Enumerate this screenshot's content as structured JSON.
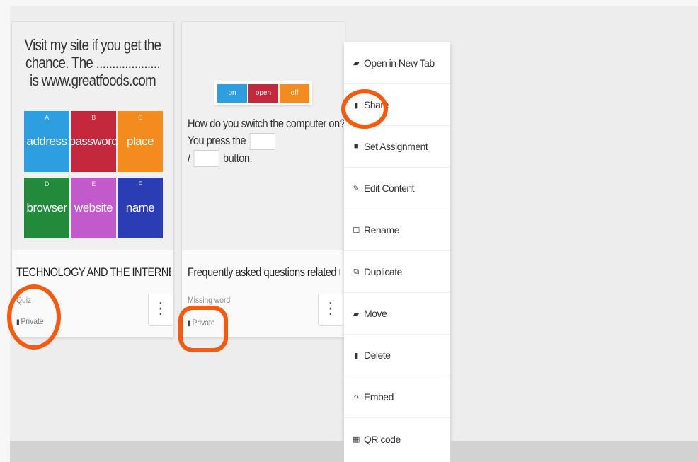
{
  "cards": [
    {
      "preview_text": "Visit my site if you get the chance. The .................... is www.greatfoods.com",
      "tiles": [
        {
          "num": "A",
          "label": "address",
          "color": "#2d9fe0"
        },
        {
          "num": "B",
          "label": "password",
          "color": "#c3283c"
        },
        {
          "num": "C",
          "label": "place",
          "color": "#f38b1e"
        },
        {
          "num": "D",
          "label": "browser",
          "color": "#238a3c"
        },
        {
          "num": "E",
          "label": "website",
          "color": "#c25acb"
        },
        {
          "num": "F",
          "label": "name",
          "color": "#2a3db4"
        }
      ],
      "title": "TECHNOLOGY AND THE INTERNET",
      "type": "Quiz",
      "privacy": "Private",
      "menu_icon": "⋮"
    },
    {
      "preview_buttons": [
        {
          "label": "on",
          "color": "#2d9fe0"
        },
        {
          "label": "open",
          "color": "#c3283c"
        },
        {
          "label": "off",
          "color": "#f38b1e"
        }
      ],
      "question": "How do you switch the computer on?",
      "line2_prefix": "You press the",
      "line3_prefix": "/",
      "line3_suffix": "button.",
      "title": "Frequently asked questions related t",
      "type": "Missing word",
      "privacy": "Private",
      "menu_icon": "⋮"
    }
  ],
  "context_menu": [
    {
      "label": "Open in New Tab",
      "icon": "folder-open-icon",
      "glyph": "▰"
    },
    {
      "label": "Share",
      "icon": "lock-icon",
      "glyph": "🔒"
    },
    {
      "label": "Set Assignment",
      "icon": "assignment-icon",
      "glyph": "■"
    },
    {
      "label": "Edit Content",
      "icon": "pencil-icon",
      "glyph": "✎"
    },
    {
      "label": "Rename",
      "icon": "rename-icon",
      "glyph": "☐"
    },
    {
      "label": "Duplicate",
      "icon": "duplicate-icon",
      "glyph": "⧉"
    },
    {
      "label": "Move",
      "icon": "move-icon",
      "glyph": "▰"
    },
    {
      "label": "Delete",
      "icon": "trash-icon",
      "glyph": "▮"
    },
    {
      "label": "Embed",
      "icon": "code-icon",
      "glyph": "‹›"
    },
    {
      "label": "QR code",
      "icon": "qr-code-icon",
      "glyph": "▦"
    }
  ],
  "annotation_color": "#f35a12"
}
